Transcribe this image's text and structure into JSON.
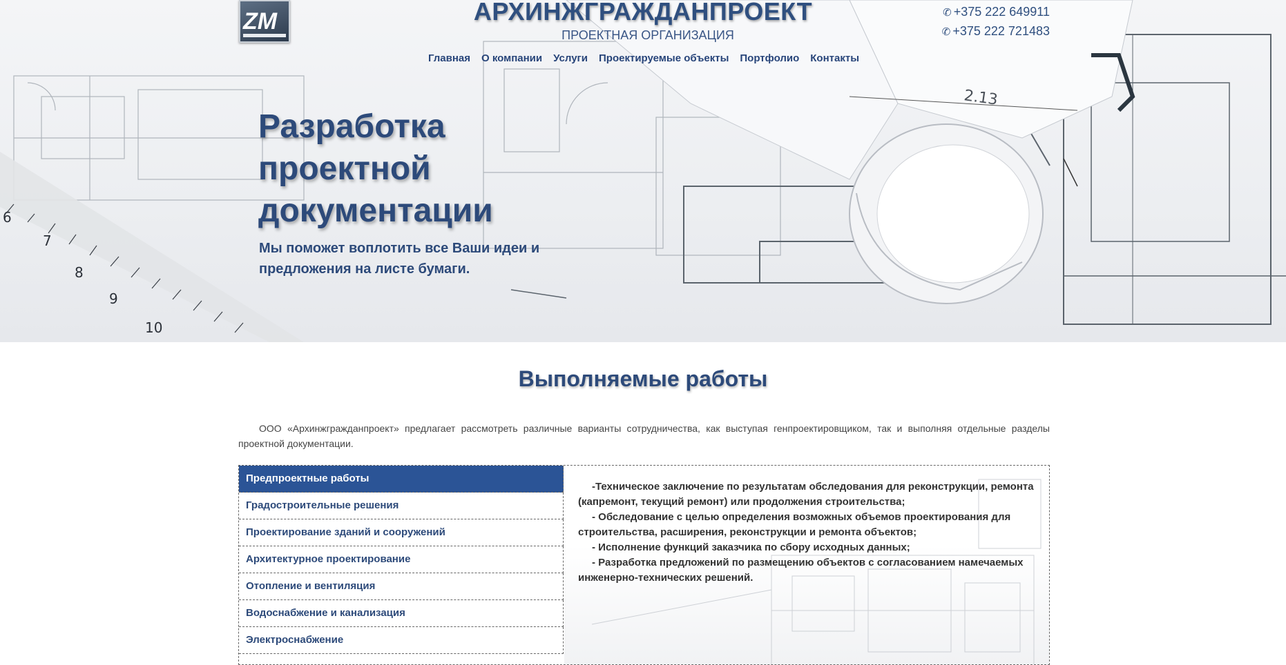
{
  "brand": {
    "title": "АРХИНЖГРАЖДАНПРОЕКТ",
    "subtitle": "ПРОЕКТНАЯ ОРГАНИЗАЦИЯ",
    "logo_icon": "company-logo"
  },
  "phones": [
    "+375 222 649911",
    "+375 222 721483"
  ],
  "nav": [
    "Главная",
    "О компании",
    "Услуги",
    "Проектируемые объекты",
    "Портфолио",
    "Контакты"
  ],
  "hero": {
    "heading": "Разработка проектной документации",
    "text": "Мы поможет воплотить все Ваши идеи и предложения на листе бумаги."
  },
  "section": {
    "title": "Выполняемые работы",
    "intro": "ООО «Архинжгражданпроект» предлагает рассмотреть различные варианты сотрудничества, как выступая генпроектировщиком, так и выполняя отдельные разделы проектной документации."
  },
  "tabs": [
    "Предпроектные работы",
    "Градостроительные решения",
    "Проектирование зданий и сооружений",
    "Архитектурное проектирование",
    "Отопление и вентиляция",
    "Водоснабжение и канализация",
    "Электроснабжение"
  ],
  "active_tab": 0,
  "content": [
    "-Техническое заключение по результатам обследования для реконструкции, ремонта (капремонт, текущий ремонт) или продолжения строительства;",
    "- Обследование с целью определения возможных объемов проектирования для строительства, расширения, реконструкции и ремонта объектов;",
    "- Исполнение функций заказчика по сбору исходных данных;",
    "- Разработка предложений по размещению объектов с согласованием намечаемых инженерно-технических решений."
  ],
  "colors": {
    "primary": "#2b5496",
    "text_blue": "#2d4a7a"
  }
}
